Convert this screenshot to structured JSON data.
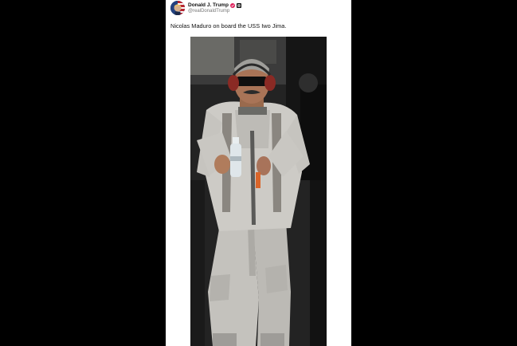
{
  "post": {
    "author": {
      "display_name": "Donald J. Trump",
      "handle": "@realDonaldTrump",
      "verified_icon": "verified-badge-icon",
      "affiliation_icon": "affiliation-flag-icon"
    },
    "text": "Nicolas Maduro on board the USS Iwo Jima.",
    "media": {
      "type": "photo",
      "icon": "photo-image"
    }
  },
  "colors": {
    "background": "#000000",
    "card": "#ffffff",
    "verified": "#e0245e",
    "handle": "#777777",
    "sweatsuit": "#c9c7c2"
  }
}
